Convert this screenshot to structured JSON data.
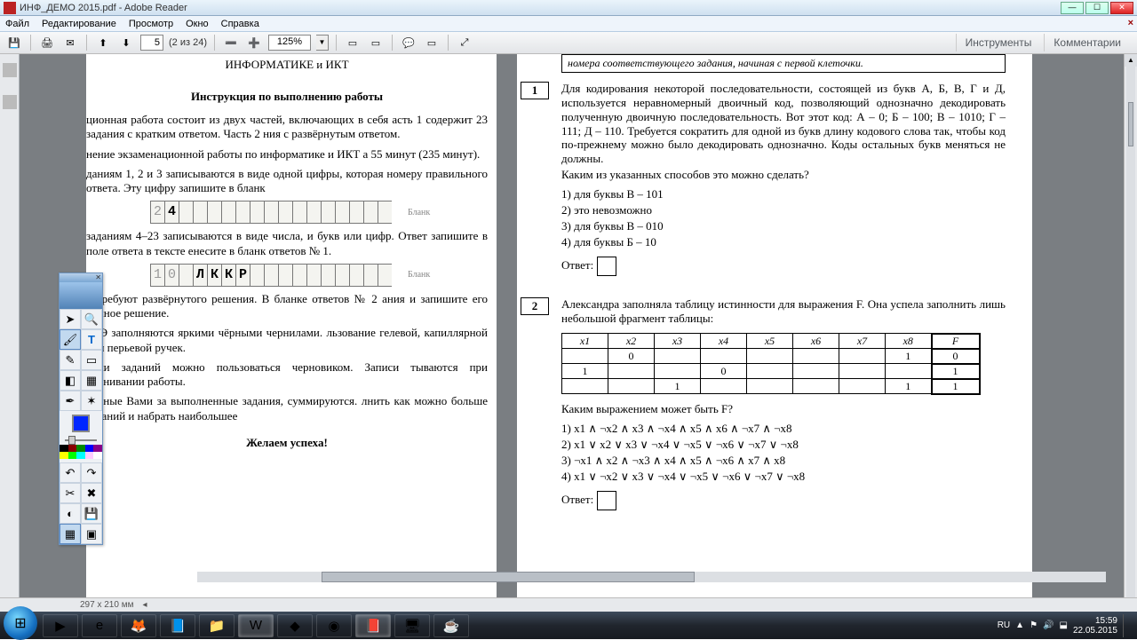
{
  "window": {
    "title": "ИНФ_ДЕМО 2015.pdf - Adobe Reader"
  },
  "menu": {
    "file": "Файл",
    "edit": "Редактирование",
    "view": "Просмотр",
    "window": "Окно",
    "help": "Справка"
  },
  "toolbar": {
    "page_current": "5",
    "page_total": "(2 из 24)",
    "zoom": "125%",
    "right1": "Инструменты",
    "right2": "Комментарии"
  },
  "sidebar": {},
  "left_page": {
    "heading": "ИНФОРМАТИКЕ и ИКТ",
    "subheading": "Инструкция по выполнению работы",
    "p1": "ционная работа состоит из двух частей, включающих в себя асть 1 содержит 23 задания с кратким ответом. Часть 2 ния с развёрнутым ответом.",
    "p2": "нение экзаменационной работы по информатике и ИКТ а 55 минут (235 минут).",
    "p3": "даниям 1, 2 и 3 записываются в виде одной цифры, которая номеру правильного ответа. Эту цифру запишите в бланк",
    "blank": "Бланк",
    "ans1_pre": "2",
    "ans1_d": "4",
    "p4": "заданиям 4–23 записываются в виде числа, и букв или цифр. Ответ запишите в поле ответа в тексте енесите в бланк ответов № 1.",
    "ans2": [
      "1",
      "0",
      "",
      "Л",
      "К",
      "К",
      "Р"
    ],
    "p5": "7 требуют развёрнутого решения. В бланке ответов № 2 ания и запишите его полное решение.",
    "p6": "ЕГЭ заполняются яркими чёрными чернилами. льзование гелевой, капиллярной или перьевой ручек.",
    "p7": "ении заданий можно пользоваться черновиком. Записи тываются при оценивании работы.",
    "p8": "ченные Вами за выполненные задания, суммируются. лнить как можно больше заданий и набрать наибольшее",
    "wish": "Желаем успеха!"
  },
  "right_page": {
    "topnote": "номера соответствующего задания, начиная с первой клеточки.",
    "q1_num": "1",
    "q1_text": "Для кодирования некоторой последовательности, состоящей из букв А, Б, В, Г и Д, используется неравномерный двоичный код, позволяющий однозначно декодировать полученную двоичную последовательность. Вот этот код: А – 0; Б – 100; В – 1010; Г – 111; Д – 110. Требуется сократить для одной из букв длину кодового слова так, чтобы код по-прежнему можно было декодировать однозначно. Коды остальных букв меняться не должны.",
    "q1_ask": "Каким из указанных способов это можно сделать?",
    "q1_opts": [
      "1)   для буквы В – 101",
      "2)   это невозможно",
      "3)   для буквы В – 010",
      "4)   для буквы Б – 10"
    ],
    "answer_label": "Ответ:",
    "q2_num": "2",
    "q2_text": "Александра заполняла таблицу истинности для выражения F. Она успела заполнить лишь небольшой фрагмент таблицы:",
    "truth_headers": [
      "x1",
      "x2",
      "x3",
      "x4",
      "x5",
      "x6",
      "x7",
      "x8",
      "F"
    ],
    "truth_rows": [
      [
        "",
        "0",
        "",
        "",
        "",
        "",
        "",
        "1",
        "0"
      ],
      [
        "1",
        "",
        "",
        "0",
        "",
        "",
        "",
        "",
        "1"
      ],
      [
        "",
        "",
        "1",
        "",
        "",
        "",
        "",
        "1",
        "1"
      ]
    ],
    "q2_ask": "Каким выражением может быть F?",
    "q2_opts": [
      "1)   x1 ∧ ¬x2 ∧ x3 ∧ ¬x4 ∧ x5 ∧ x6 ∧ ¬x7 ∧ ¬x8",
      "2)   x1 ∨ x2 ∨ x3 ∨ ¬x4 ∨ ¬x5 ∨ ¬x6 ∨ ¬x7 ∨ ¬x8",
      "3)   ¬x1 ∧ x2 ∧ ¬x3 ∧ x4 ∧ x5 ∧ ¬x6 ∧ x7 ∧ x8",
      "4)   x1 ∨ ¬x2 ∨ x3 ∨ ¬x4 ∨ ¬x5 ∨ ¬x6 ∨ ¬x7 ∨ ¬x8"
    ]
  },
  "status": {
    "dims": "297 x 210 мм"
  },
  "tray": {
    "lang": "RU",
    "time": "15:59",
    "date": "22.05.2015"
  },
  "palette_colors": {
    "main": "#0026ff",
    "row1": [
      "#000",
      "#800",
      "#080",
      "#880",
      "#008"
    ],
    "row2": [
      "#ff0",
      "#0f0",
      "#0ff",
      "#f0f",
      "#fff"
    ]
  }
}
